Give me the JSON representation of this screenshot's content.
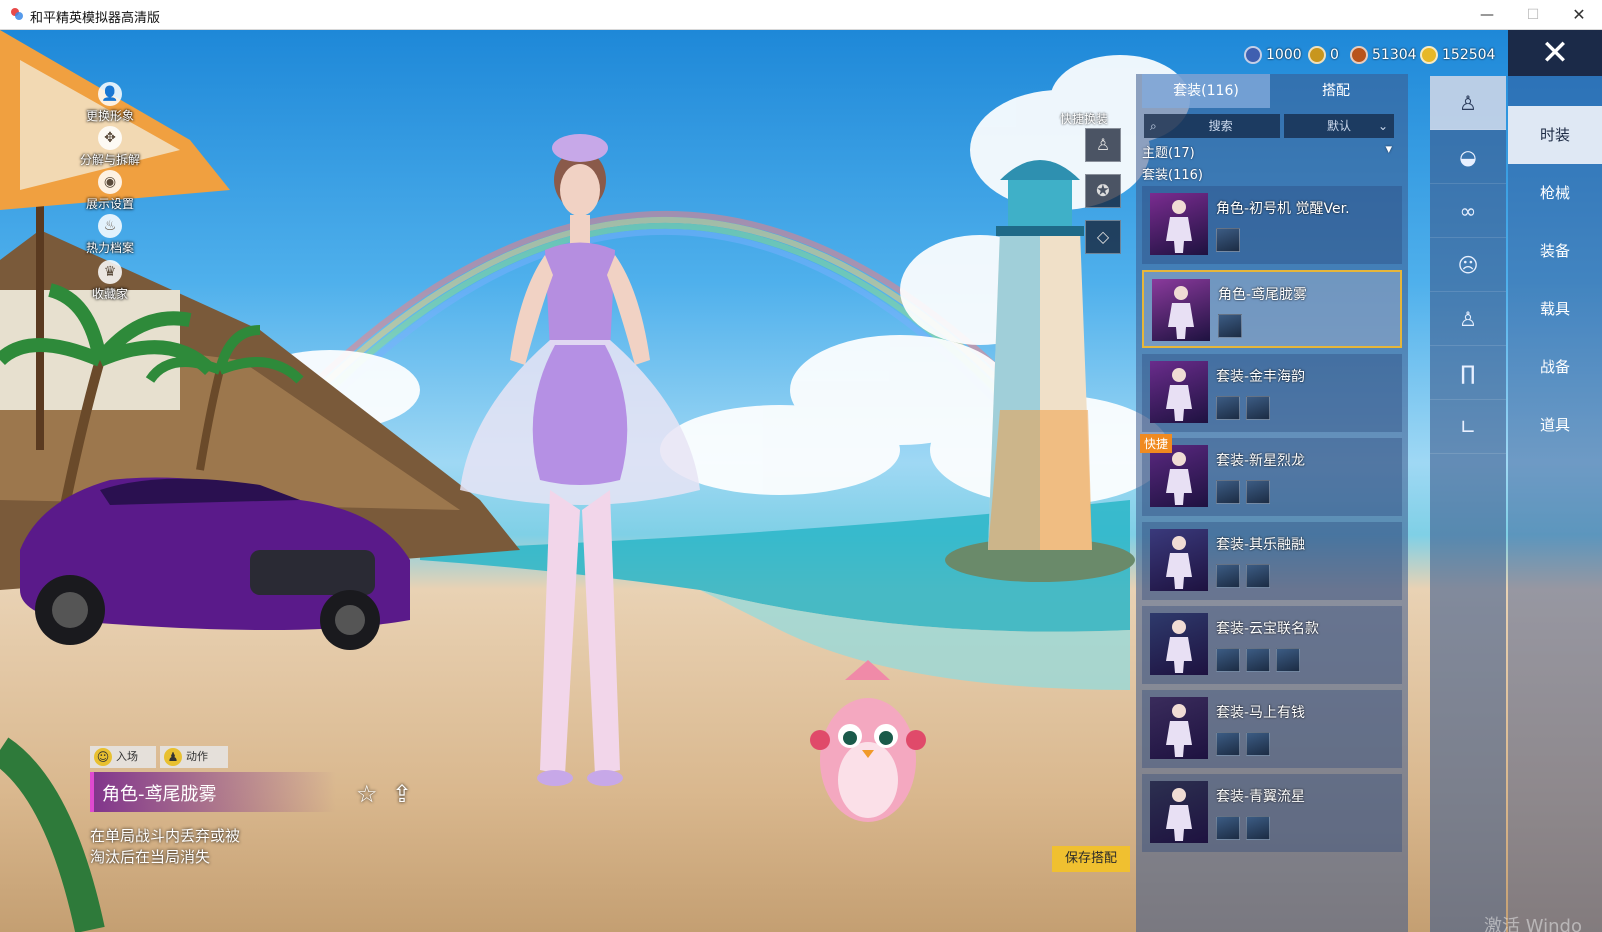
{
  "window": {
    "title": "和平精英模拟器高清版",
    "min_glyph": "—",
    "max_glyph": "☐",
    "close_glyph": "✕"
  },
  "left_tools": [
    {
      "label": "更换形象",
      "icon": "person-icon",
      "glyph": "👤"
    },
    {
      "label": "分解与拆解",
      "icon": "decompose-icon",
      "glyph": "✥"
    },
    {
      "label": "展示设置",
      "icon": "eye-icon",
      "glyph": "◉"
    },
    {
      "label": "热力档案",
      "icon": "flame-icon",
      "glyph": "♨"
    },
    {
      "label": "收藏家",
      "icon": "collector-icon",
      "glyph": "♛"
    }
  ],
  "currencies": [
    {
      "value": "1000",
      "color": "#3f5fb0"
    },
    {
      "value": "0",
      "color": "#c8961e"
    },
    {
      "value": "51304",
      "color": "#b8541c"
    },
    {
      "value": "152504",
      "color": "#e6b828"
    }
  ],
  "close_glyph": "✕",
  "quick_change": {
    "label": "快捷换装"
  },
  "panel": {
    "tabs": [
      {
        "label": "套装(116)"
      },
      {
        "label": "搭配"
      }
    ],
    "search_placeholder": "搜索",
    "search_glyph": "⌕",
    "sort_value": "默认",
    "sort_glyph": "⌄",
    "sections": [
      {
        "label": "主题(17)",
        "glyph": "▾"
      },
      {
        "label": "套装(116)"
      }
    ],
    "items": [
      {
        "name": "角色-初号机 觉醒Ver.",
        "subs": 1,
        "selected": false,
        "quick": false,
        "tint": "#7a2c90"
      },
      {
        "name": "角色-鸢尾胧雾",
        "subs": 1,
        "selected": true,
        "quick": false,
        "tint": "#8a3a9c"
      },
      {
        "name": "套装-金丰海韵",
        "subs": 2,
        "selected": false,
        "quick": false,
        "tint": "#6a2c8c"
      },
      {
        "name": "套装-新星烈龙",
        "subs": 2,
        "selected": false,
        "quick": true,
        "tint": "#5a2880"
      },
      {
        "name": "套装-其乐融融",
        "subs": 2,
        "selected": false,
        "quick": false,
        "tint": "#3a3a7c"
      },
      {
        "name": "套装-云宝联名款",
        "subs": 3,
        "selected": false,
        "quick": false,
        "tint": "#2e3a6c"
      },
      {
        "name": "套装-马上有钱",
        "subs": 2,
        "selected": false,
        "quick": false,
        "tint": "#3a2c5c"
      },
      {
        "name": "套装-青翼流星",
        "subs": 2,
        "selected": false,
        "quick": false,
        "tint": "#2c3050"
      }
    ],
    "quick_badge": "快捷"
  },
  "categories": [
    {
      "icon": "outfit-icon",
      "glyph": "♙",
      "active": true
    },
    {
      "icon": "hat-icon",
      "glyph": "◒",
      "active": false
    },
    {
      "icon": "glasses-icon",
      "glyph": "∞",
      "active": false
    },
    {
      "icon": "mask-icon",
      "glyph": "☹",
      "active": false
    },
    {
      "icon": "top-icon",
      "glyph": "♙",
      "active": false
    },
    {
      "icon": "pants-icon",
      "glyph": "∏",
      "active": false
    },
    {
      "icon": "shoes-icon",
      "glyph": "∟",
      "active": false
    }
  ],
  "side_tabs": [
    {
      "label": "时装",
      "active": true
    },
    {
      "label": "枪械",
      "active": false
    },
    {
      "label": "装备",
      "active": false
    },
    {
      "label": "载具",
      "active": false
    },
    {
      "label": "战备",
      "active": false
    },
    {
      "label": "道具",
      "active": false
    }
  ],
  "actions": [
    {
      "label": "入场",
      "glyph": "☺"
    },
    {
      "label": "动作",
      "glyph": "♟"
    }
  ],
  "selected_name": "角色-鸢尾胧雾",
  "fav_glyph": "☆",
  "share_glyph": "⇪",
  "description": [
    "在单局战斗内丢弃或被",
    "淘汰后在当局消失"
  ],
  "save_button": "保存搭配",
  "watermark": "激活 Windo"
}
